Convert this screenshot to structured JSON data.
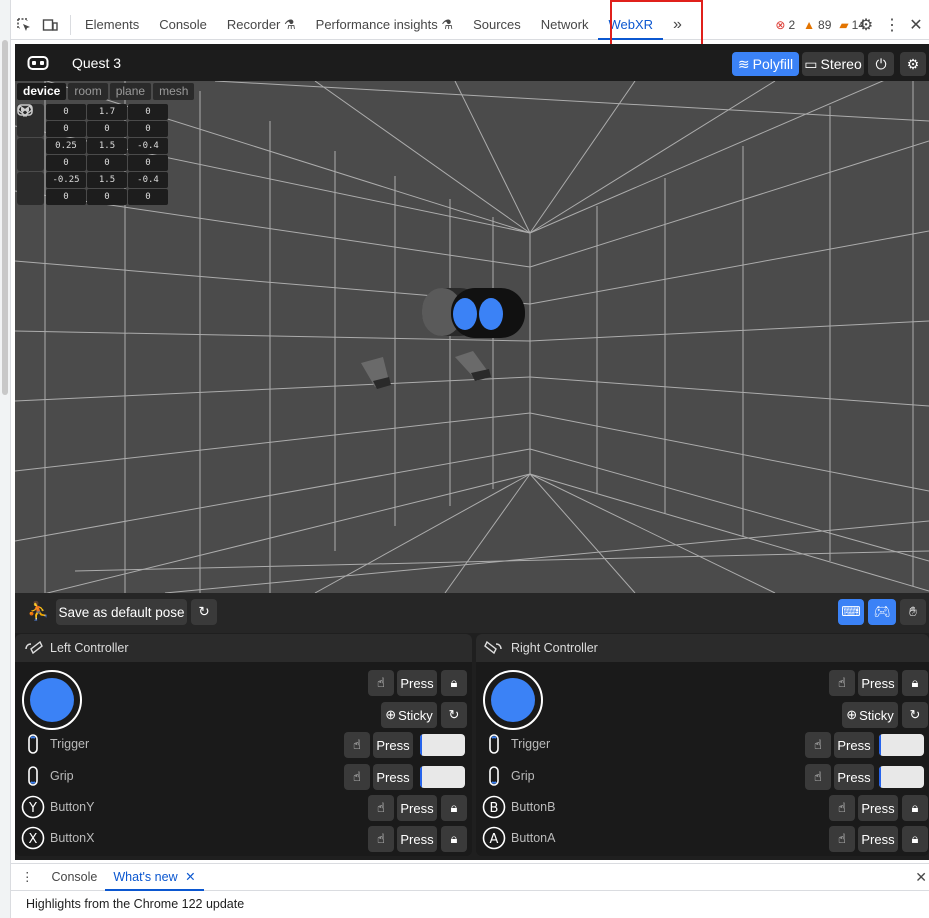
{
  "devtools": {
    "tabs": [
      "Elements",
      "Console",
      "Recorder",
      "Performance insights",
      "Sources",
      "Network",
      "WebXR"
    ],
    "active_tab": "WebXR",
    "more_tabs": "»",
    "errors": "2",
    "warnings": "89",
    "issues": "14"
  },
  "webxr": {
    "device_name": "Quest 3",
    "polyfill_label": "Polyfill",
    "stereo_label": "Stereo",
    "scene_tabs": [
      "device",
      "room",
      "plane",
      "mesh"
    ],
    "active_scene_tab": "device",
    "poses": [
      {
        "icon": "headset-icon",
        "values": [
          "0",
          "1.7",
          "0",
          "0",
          "0",
          "0"
        ]
      },
      {
        "icon": "right-controller-icon",
        "values": [
          "0.25",
          "1.5",
          "-0.4",
          "0",
          "0",
          "0"
        ]
      },
      {
        "icon": "left-controller-icon",
        "values": [
          "-0.25",
          "1.5",
          "-0.4",
          "0",
          "0",
          "0"
        ]
      }
    ],
    "save_pose_label": "Save as default pose",
    "left": {
      "title": "Left Controller",
      "press": "Press",
      "sticky": "Sticky",
      "buttons": [
        {
          "label": "Trigger",
          "icon": "trigger-icon",
          "analog": true,
          "value": 0.05
        },
        {
          "label": "Grip",
          "icon": "grip-icon",
          "analog": true,
          "value": 0.05
        },
        {
          "label": "ButtonY",
          "icon": "Y"
        },
        {
          "label": "ButtonX",
          "icon": "X"
        }
      ]
    },
    "right": {
      "title": "Right Controller",
      "press": "Press",
      "sticky": "Sticky",
      "buttons": [
        {
          "label": "Trigger",
          "icon": "trigger-icon",
          "analog": true,
          "value": 0.05
        },
        {
          "label": "Grip",
          "icon": "grip-icon",
          "analog": true,
          "value": 0.05
        },
        {
          "label": "ButtonB",
          "icon": "B"
        },
        {
          "label": "ButtonA",
          "icon": "A"
        }
      ]
    },
    "colors": {
      "accent": "#3b82f6",
      "panel": "#1a1a1a",
      "scene": "#4b4b4b"
    }
  },
  "drawer": {
    "tabs": [
      "Console",
      "What's new"
    ],
    "active_tab": "What's new",
    "text": "Highlights from the Chrome 122 update"
  }
}
